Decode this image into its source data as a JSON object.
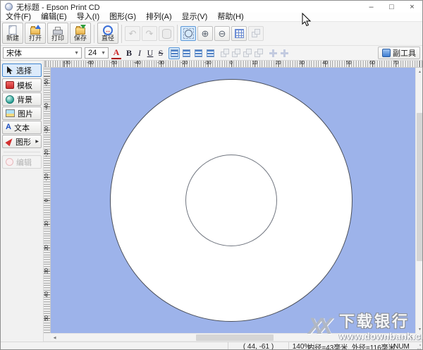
{
  "window": {
    "title": "无标题 - Epson Print CD",
    "minimize_glyph": "–",
    "maximize_glyph": "□",
    "close_glyph": "×"
  },
  "menu": {
    "items": [
      "文件(F)",
      "编辑(E)",
      "导入(I)",
      "图形(G)",
      "排列(A)",
      "显示(V)",
      "帮助(H)"
    ]
  },
  "toolbar": {
    "buttons": [
      "新建",
      "打开",
      "打印",
      "保存",
      "直径"
    ],
    "glyphs": {
      "undo": "↶",
      "redo": "↷",
      "zoom_in": "⊕",
      "zoom_out": "⊖"
    }
  },
  "fontbar": {
    "font_family": "宋体",
    "font_size": "24",
    "color": "A",
    "bold": "B",
    "italic": "I",
    "underline": "U",
    "strike": "S",
    "subtools": "副工具"
  },
  "sidebar": {
    "items": [
      {
        "label": "选择",
        "selected": true
      },
      {
        "label": "模板"
      },
      {
        "label": "背景"
      },
      {
        "label": "图片"
      },
      {
        "label": "文本"
      },
      {
        "label": "图形"
      },
      {
        "label": "编辑",
        "disabled": true
      }
    ]
  },
  "rulers": {
    "horizontal": {
      "labels": [
        "-70",
        "-60",
        "-50",
        "-40",
        "-30",
        "-20",
        "-10",
        "0",
        "10",
        "20",
        "30",
        "40",
        "50",
        "60",
        "70"
      ]
    },
    "vertical": {
      "labels": [
        "-50",
        "-40",
        "-30",
        "-20",
        "-10",
        "0",
        "10",
        "20",
        "30",
        "40",
        "50"
      ]
    }
  },
  "canvas": {
    "background": "#9db3ea",
    "disc_fill": "#ffffff",
    "disc_outline": "#4a4f5a",
    "inner_outline": "#70757f"
  },
  "scrollbars": {
    "up": "▲",
    "down": "▼",
    "left": "◀",
    "right": "▶"
  },
  "statusbar": {
    "coordinates": "( 44, -61 )",
    "zoom": "140%",
    "dimensions": "内径=43毫米, 外径=116毫米",
    "numlock": "NUM"
  },
  "watermark": {
    "logo": "XX",
    "title": "下载银行",
    "url": "www.downbank.cn"
  },
  "accent_color": "#5e9ad9"
}
